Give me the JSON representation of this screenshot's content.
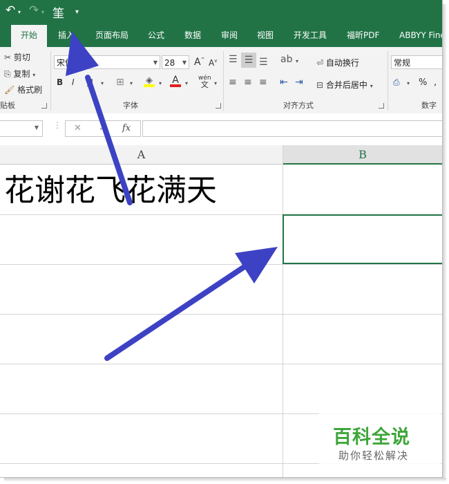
{
  "quick_access": {
    "undo_label": "↶",
    "redo_label": "↷",
    "extra_label": "筀",
    "customize_label": "▾"
  },
  "tabs": [
    "开始",
    "插入",
    "页面布局",
    "公式",
    "数据",
    "审阅",
    "视图",
    "开发工具",
    "福昕PDF",
    "ABBYY Fine"
  ],
  "ribbon": {
    "clipboard": {
      "cut": "剪切",
      "copy": "复制",
      "format_painter": "格式刷",
      "group_label": "贴板"
    },
    "font": {
      "font_name": "宋体",
      "font_size": "28",
      "bold": "B",
      "italic": "I",
      "underline": "U",
      "grow": "A",
      "shrink": "A",
      "font_color": "A",
      "pinyin_top": "wén",
      "pinyin_bottom": "文",
      "group_label": "字体"
    },
    "alignment": {
      "wrap_text": "自动换行",
      "merge_center": "合并后居中",
      "group_label": "对齐方式"
    },
    "number": {
      "format": "常规",
      "percent": "%",
      "group_label": "数字"
    }
  },
  "formula_bar": {
    "cancel": "✕",
    "confirm": "✓",
    "fx": "fx",
    "value": ""
  },
  "sheet": {
    "columns": [
      "A",
      "B"
    ],
    "cell_a1": "花谢花飞花满天"
  },
  "watermark": {
    "title": "百科全说",
    "subtitle": "助你轻松解决"
  },
  "colors": {
    "accent": "#217346",
    "arrow": "#3d42c4",
    "watermark": "#3ea63a"
  }
}
